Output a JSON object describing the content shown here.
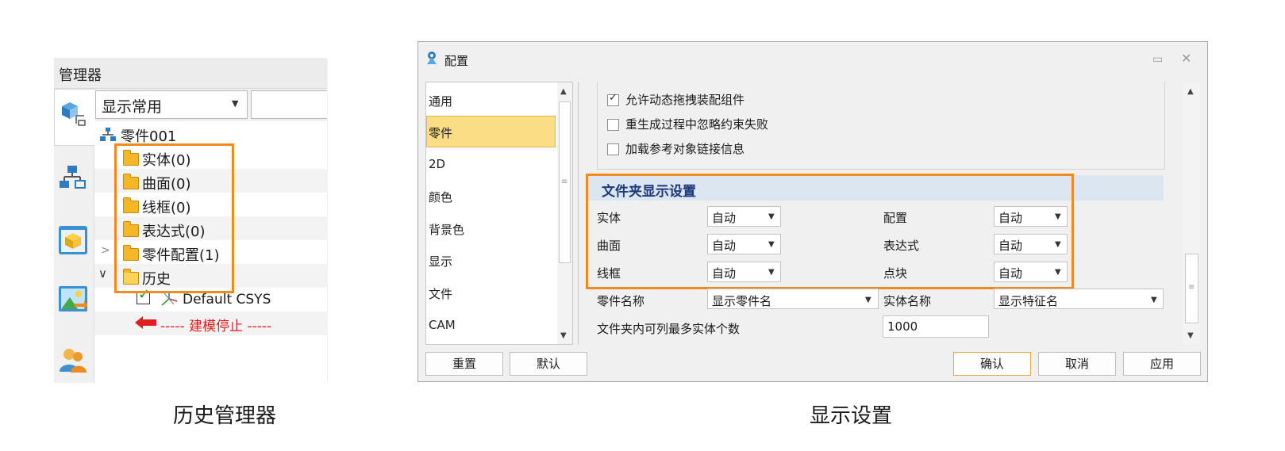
{
  "left_panel": {
    "title": "管理器",
    "filter_value": "显示常用",
    "tree": [
      {
        "label": "零件001"
      },
      {
        "label": "实体(0)"
      },
      {
        "label": "曲面(0)"
      },
      {
        "label": "线框(0)"
      },
      {
        "label": "表达式(0)"
      },
      {
        "label": "零件配置(1)"
      },
      {
        "label": "历史"
      },
      {
        "label": "Default CSYS"
      },
      {
        "label": "----- 建模停止 -----"
      }
    ]
  },
  "dialog": {
    "title": "配置",
    "categories": [
      "通用",
      "零件",
      "2D",
      "颜色",
      "背景色",
      "显示",
      "文件",
      "CAM"
    ],
    "selected_category": "零件",
    "checkboxes": [
      {
        "label": "允许动态拖拽装配组件",
        "checked": true
      },
      {
        "label": "重生成过程中忽略约束失败",
        "checked": false
      },
      {
        "label": "加载参考对象链接信息",
        "checked": false
      }
    ],
    "section_title": "文件夹显示设置",
    "folder_settings": [
      {
        "label": "实体",
        "value": "自动"
      },
      {
        "label": "配置",
        "value": "自动"
      },
      {
        "label": "曲面",
        "value": "自动"
      },
      {
        "label": "表达式",
        "value": "自动"
      },
      {
        "label": "线框",
        "value": "自动"
      },
      {
        "label": "点块",
        "value": "自动"
      }
    ],
    "part_name_label": "零件名称",
    "part_name_value": "显示零件名",
    "body_name_label": "实体名称",
    "body_name_value": "显示特征名",
    "max_bodies_label": "文件夹内可列最多实体个数",
    "max_bodies_value": "1000",
    "buttons": {
      "reset": "重置",
      "default": "默认",
      "ok": "确认",
      "cancel": "取消",
      "apply": "应用"
    }
  },
  "captions": {
    "left": "历史管理器",
    "right": "显示设置"
  },
  "colors": {
    "highlight": "#f08a1c",
    "selected_category": "#fbdd86",
    "section_band": "#dbe6f0",
    "section_title": "#1d3a78",
    "stop_text": "#e02020"
  }
}
